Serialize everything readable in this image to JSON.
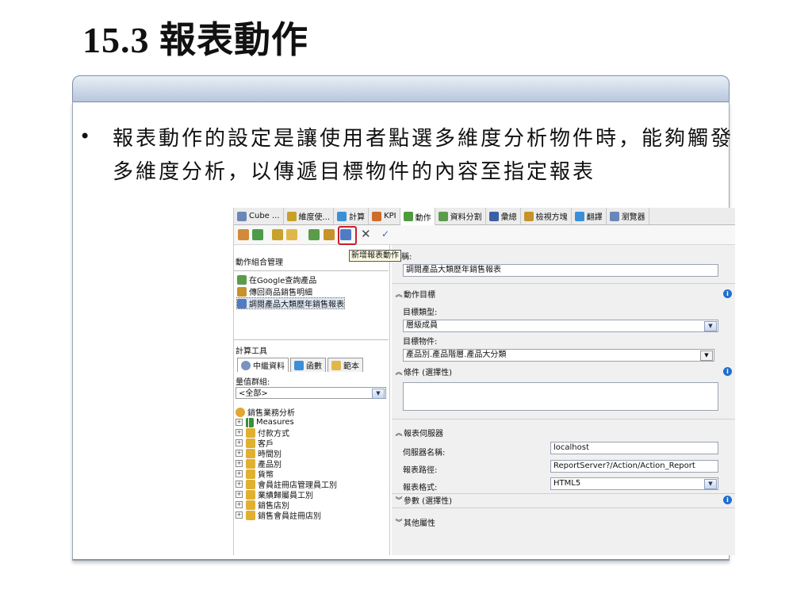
{
  "slide": {
    "title": "15.3 報表動作",
    "bullet": "報表動作的設定是讓使用者點選多維度分析物件時，能夠觸發多維度分析，以傳遞目標物件的內容至指定報表"
  },
  "tabs": [
    {
      "label": "Cube ...",
      "icon": "cube-icon",
      "color": "#6b86b8"
    },
    {
      "label": "維度使...",
      "icon": "dimension-usage-icon",
      "color": "#c7a12a"
    },
    {
      "label": "計算",
      "icon": "calculation-icon",
      "color": "#3a8fd8"
    },
    {
      "label": "KPI",
      "icon": "kpi-icon",
      "color": "#d06b2a"
    },
    {
      "label": "動作",
      "icon": "action-icon",
      "color": "#4c9b3c"
    },
    {
      "label": "資料分割",
      "icon": "partition-icon",
      "color": "#5a9c4a"
    },
    {
      "label": "彙總",
      "icon": "aggregation-icon",
      "color": "#3b5ea8"
    },
    {
      "label": "檢視方塊",
      "icon": "perspective-icon",
      "color": "#c7922a"
    },
    {
      "label": "翻譯",
      "icon": "translation-icon",
      "color": "#3a8fd8"
    },
    {
      "label": "瀏覽器",
      "icon": "browser-icon",
      "color": "#6b86b8"
    }
  ],
  "toolbar": {
    "tooltip": "新增報表動作",
    "buttons": [
      "process-icon",
      "refresh-icon",
      "new-action-icon",
      "new-drillthrough-icon",
      "new-report-action-icon",
      "delete-icon",
      "spellcheck-icon"
    ]
  },
  "left": {
    "action_org_label": "動作組合管理",
    "actions": [
      "在Google查詢產品",
      "傳回商品銷售明細",
      "調閱產品大類歷年銷售報表"
    ],
    "calc_tools_label": "計算工具",
    "subtabs": [
      "中繼資料",
      "函數",
      "範本"
    ],
    "measure_group_label": "量值群組:",
    "measure_group_value": "<全部>",
    "tree_root": "銷售業務分析",
    "tree_items": [
      "Measures",
      "付款方式",
      "客戶",
      "時間別",
      "產品別",
      "貨幣",
      "會員註冊店管理員工別",
      "業績歸屬員工別",
      "銷售店別",
      "銷售會員註冊店別"
    ]
  },
  "right": {
    "name_label": "稱:",
    "name_value": "調閱產品大類歷年銷售報表",
    "target_section": "動作目標",
    "target_type_label": "目標類型:",
    "target_type_value": "層級成員",
    "target_object_label": "目標物件:",
    "target_object_value": "產品別.產品階層.產品大分類",
    "condition_section": "條件 (選擇性)",
    "report_server_section": "報表伺服器",
    "server_name_label": "伺服器名稱:",
    "server_name_value": "localhost",
    "report_path_label": "報表路徑:",
    "report_path_value": "ReportServer?/Action/Action_Report",
    "report_format_label": "報表格式:",
    "report_format_value": "HTML5",
    "params_section": "參數 (選擇性)",
    "other_section": "其他屬性"
  }
}
